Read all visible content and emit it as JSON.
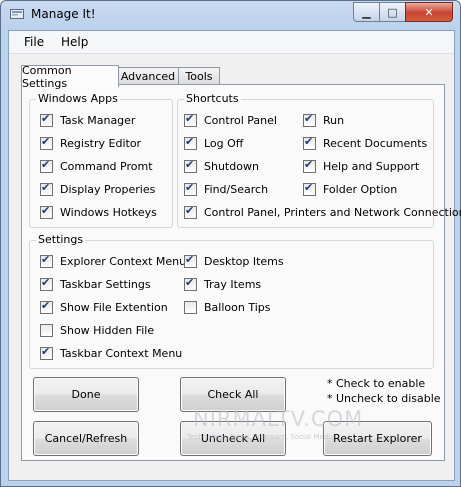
{
  "window": {
    "title": "Manage It!",
    "minimize_glyph": "▁",
    "maximize_glyph": "□",
    "close_glyph": "✕",
    "app_icon": "app-icon"
  },
  "menu": [
    {
      "label": "File"
    },
    {
      "label": "Help"
    }
  ],
  "tabs": [
    {
      "label": "Common Settings",
      "active": true
    },
    {
      "label": "Advanced",
      "active": false
    },
    {
      "label": "Tools",
      "active": false
    }
  ],
  "windows_apps": {
    "title": "Windows Apps",
    "items": [
      {
        "label": "Task Manager",
        "checked": true
      },
      {
        "label": "Registry Editor",
        "checked": true
      },
      {
        "label": "Command Promt",
        "checked": true
      },
      {
        "label": "Display Properies",
        "checked": true
      },
      {
        "label": "Windows Hotkeys",
        "checked": true
      }
    ]
  },
  "shortcuts": {
    "title": "Shortcuts",
    "col1": [
      {
        "label": "Control Panel",
        "checked": true
      },
      {
        "label": "Log Off",
        "checked": true
      },
      {
        "label": "Shutdown",
        "checked": true
      },
      {
        "label": "Find/Search",
        "checked": true
      }
    ],
    "col2": [
      {
        "label": "Run",
        "checked": true
      },
      {
        "label": "Recent Documents",
        "checked": true
      },
      {
        "label": "Help and Support",
        "checked": true
      },
      {
        "label": "Folder Option",
        "checked": true
      }
    ],
    "wide": {
      "label": "Control Panel, Printers and Network Connection",
      "checked": true
    }
  },
  "settings": {
    "title": "Settings",
    "col1": [
      {
        "label": "Explorer Context Menu",
        "checked": true
      },
      {
        "label": "Taskbar Settings",
        "checked": true
      },
      {
        "label": "Show File Extention",
        "checked": true
      },
      {
        "label": "Show Hidden File",
        "checked": false
      },
      {
        "label": "Taskbar Context Menu",
        "checked": true
      }
    ],
    "col2": [
      {
        "label": "Desktop Items",
        "checked": true
      },
      {
        "label": "Tray Items",
        "checked": true
      },
      {
        "label": "Balloon Tips",
        "checked": false
      }
    ]
  },
  "buttons": {
    "done": "Done",
    "check_all": "Check All",
    "cancel_refresh": "Cancel/Refresh",
    "uncheck_all": "Uncheck All",
    "restart_explorer": "Restart Explorer"
  },
  "notes": {
    "check": "* Check to enable",
    "uncheck": "* Uncheck to disable"
  },
  "watermark": {
    "text": "NIRMALTV.COM",
    "sub": "Technology, News, Freeware, Social Media"
  }
}
